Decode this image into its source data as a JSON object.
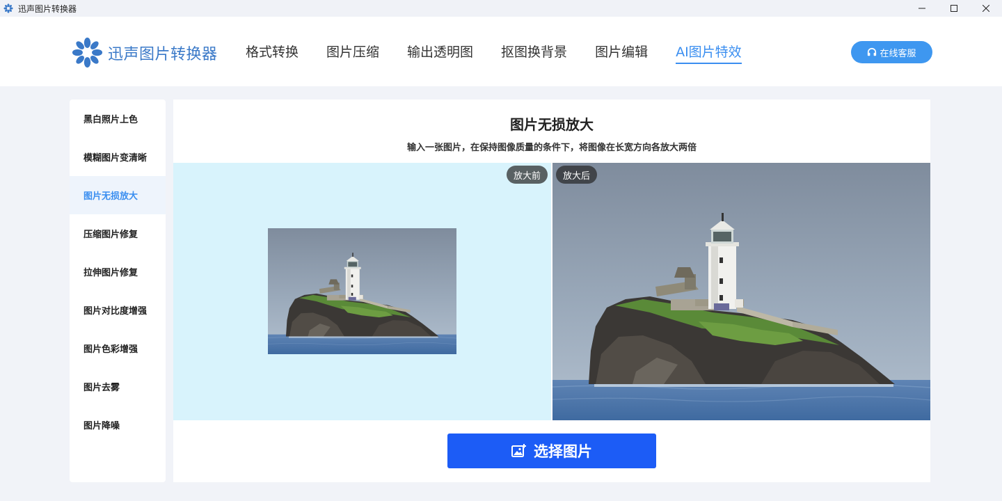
{
  "window": {
    "title": "迅声图片转换器",
    "controls": [
      "minimize",
      "maximize",
      "close"
    ]
  },
  "header": {
    "logo_text": "迅声图片转换器",
    "nav": [
      {
        "label": "格式转换",
        "active": false
      },
      {
        "label": "图片压缩",
        "active": false
      },
      {
        "label": "输出透明图",
        "active": false
      },
      {
        "label": "抠图换背景",
        "active": false
      },
      {
        "label": "图片编辑",
        "active": false
      },
      {
        "label": "AI图片特效",
        "active": true
      }
    ],
    "service_label": "在线客服"
  },
  "sidebar": {
    "items": [
      {
        "label": "黑白照片上色",
        "active": false
      },
      {
        "label": "模糊图片变清晰",
        "active": false
      },
      {
        "label": "图片无损放大",
        "active": true
      },
      {
        "label": "压缩图片修复",
        "active": false
      },
      {
        "label": "拉伸图片修复",
        "active": false
      },
      {
        "label": "图片对比度增强",
        "active": false
      },
      {
        "label": "图片色彩增强",
        "active": false
      },
      {
        "label": "图片去雾",
        "active": false
      },
      {
        "label": "图片降噪",
        "active": false
      }
    ]
  },
  "main": {
    "title": "图片无损放大",
    "subtitle": "输入一张图片，在保持图像质量的条件下，将图像在长宽方向各放大两倍",
    "before_label": "放大前",
    "after_label": "放大后",
    "select_button": "选择图片"
  },
  "colors": {
    "accent": "#3a8ef0",
    "logo": "#3a79c8",
    "primary_button": "#1c5cf6",
    "service_button": "#3e97f0",
    "before_bg": "#d8f3fc"
  },
  "icons": {
    "app": "snowflake-logo-icon",
    "service": "headset-icon",
    "select": "image-add-icon"
  }
}
